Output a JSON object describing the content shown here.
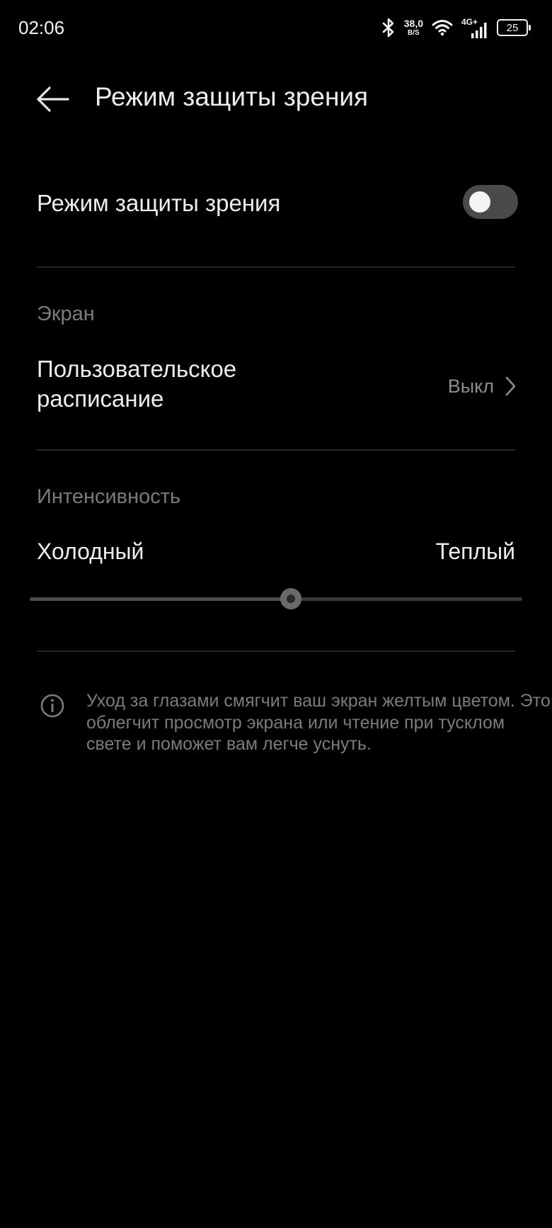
{
  "status_bar": {
    "time": "02:06",
    "net_speed_value": "38,0",
    "net_speed_unit": "B/S",
    "network_type": "4G+",
    "battery": "25",
    "icons": [
      "bluetooth-icon",
      "wifi-icon",
      "cell-signal-icon",
      "battery-icon"
    ]
  },
  "header": {
    "title": "Режим защиты зрения",
    "back_icon": "arrow-left-icon"
  },
  "eye_comfort": {
    "label": "Режим защиты зрения",
    "enabled": false
  },
  "screen_section": {
    "title": "Экран",
    "schedule_label": "Пользовательское расписание",
    "schedule_value": "Выкл"
  },
  "intensity_section": {
    "title": "Интенсивность",
    "min_label": "Холодный",
    "max_label": "Теплый",
    "value_fraction": 0.53
  },
  "info": {
    "icon": "info-icon",
    "text": "Уход за глазами смягчит ваш экран желтым цветом. Это облегчит просмотр экрана или чтение при тусклом свете и поможет вам легче уснуть."
  },
  "colors": {
    "background": "#000000",
    "toggle_off": "#4a4a4a",
    "secondary_text": "#7a7a7a"
  }
}
